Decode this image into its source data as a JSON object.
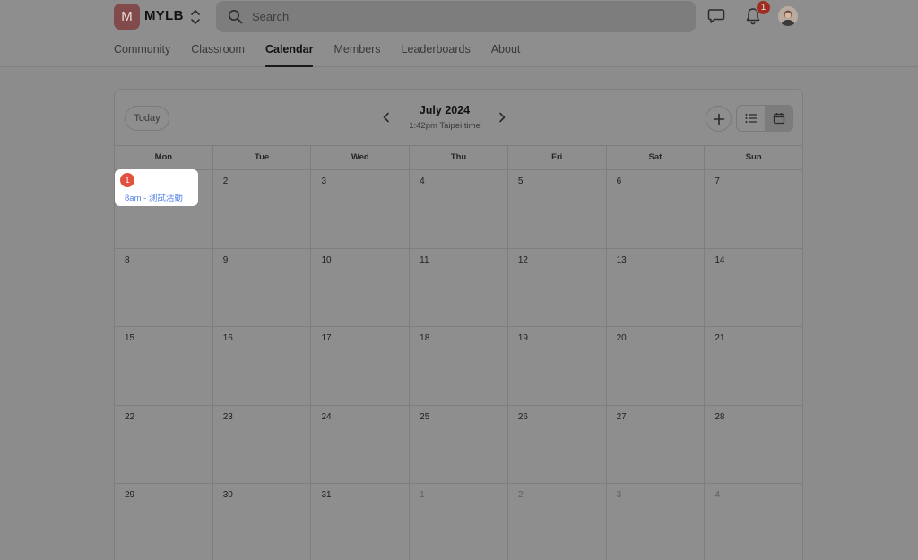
{
  "header": {
    "logo_letter": "M",
    "brand": "MYLB",
    "search_placeholder": "Search",
    "notification_count": "1"
  },
  "nav": {
    "tabs": [
      {
        "label": "Community",
        "active": false
      },
      {
        "label": "Classroom",
        "active": false
      },
      {
        "label": "Calendar",
        "active": true
      },
      {
        "label": "Members",
        "active": false
      },
      {
        "label": "Leaderboards",
        "active": false
      },
      {
        "label": "About",
        "active": false
      }
    ]
  },
  "calendar": {
    "today_label": "Today",
    "month_title": "July 2024",
    "timezone_text": "1:42pm Taipei time",
    "weekdays": [
      "Mon",
      "Tue",
      "Wed",
      "Thu",
      "Fri",
      "Sat",
      "Sun"
    ],
    "weeks": [
      [
        {
          "d": "1"
        },
        {
          "d": "2"
        },
        {
          "d": "3"
        },
        {
          "d": "4"
        },
        {
          "d": "5"
        },
        {
          "d": "6"
        },
        {
          "d": "7"
        }
      ],
      [
        {
          "d": "8"
        },
        {
          "d": "9"
        },
        {
          "d": "10"
        },
        {
          "d": "11"
        },
        {
          "d": "12"
        },
        {
          "d": "13"
        },
        {
          "d": "14"
        }
      ],
      [
        {
          "d": "15"
        },
        {
          "d": "16"
        },
        {
          "d": "17"
        },
        {
          "d": "18"
        },
        {
          "d": "19"
        },
        {
          "d": "20"
        },
        {
          "d": "21"
        }
      ],
      [
        {
          "d": "22"
        },
        {
          "d": "23"
        },
        {
          "d": "24"
        },
        {
          "d": "25"
        },
        {
          "d": "26"
        },
        {
          "d": "27"
        },
        {
          "d": "28"
        }
      ],
      [
        {
          "d": "29"
        },
        {
          "d": "30"
        },
        {
          "d": "31"
        },
        {
          "d": "1",
          "other": true
        },
        {
          "d": "2",
          "other": true
        },
        {
          "d": "3",
          "other": true
        },
        {
          "d": "4",
          "other": true
        }
      ]
    ],
    "highlight": {
      "day": "1",
      "event": "8am - 測試活動"
    }
  },
  "colors": {
    "badge_red": "#e2503e",
    "event_blue": "#4f80e6",
    "logo_bg": "#824b4b"
  }
}
